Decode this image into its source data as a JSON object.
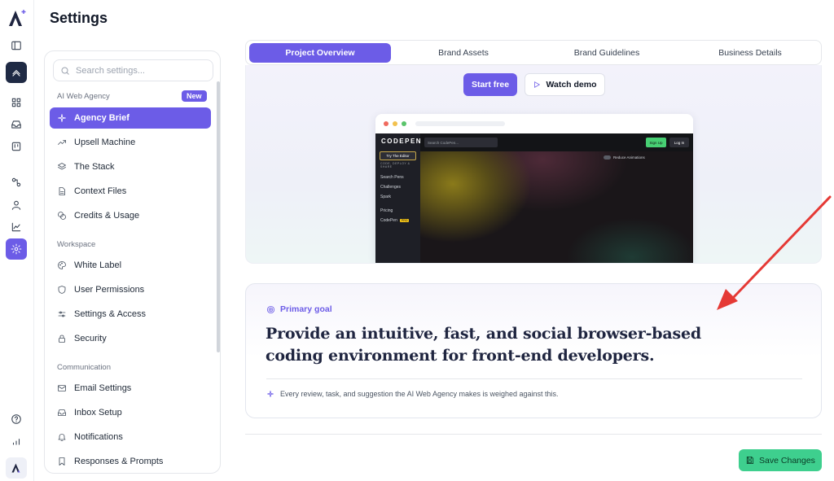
{
  "header": {
    "title": "Settings"
  },
  "sidebar": {
    "search_placeholder": "Search settings...",
    "sections": [
      {
        "heading": "AI Web Agency",
        "badge": "New"
      },
      {
        "heading": "Workspace"
      },
      {
        "heading": "Communication"
      }
    ],
    "items": [
      {
        "label": "Agency Brief",
        "icon": "sparkle-icon"
      },
      {
        "label": "Upsell Machine",
        "icon": "trend-up-icon"
      },
      {
        "label": "The Stack",
        "icon": "layers-icon"
      },
      {
        "label": "Context Files",
        "icon": "file-icon"
      },
      {
        "label": "Credits & Usage",
        "icon": "coins-icon"
      },
      {
        "label": "White Label",
        "icon": "palette-icon"
      },
      {
        "label": "User Permissions",
        "icon": "shield-icon"
      },
      {
        "label": "Settings & Access",
        "icon": "sliders-icon"
      },
      {
        "label": "Security",
        "icon": "lock-icon"
      },
      {
        "label": "Email Settings",
        "icon": "mail-icon"
      },
      {
        "label": "Inbox Setup",
        "icon": "inbox-icon"
      },
      {
        "label": "Notifications",
        "icon": "bell-icon"
      },
      {
        "label": "Responses & Prompts",
        "icon": "bookmark-icon"
      }
    ]
  },
  "tabs": [
    "Project Overview",
    "Brand Assets",
    "Brand Guidelines",
    "Business Details"
  ],
  "hero": {
    "start_label": "Start free",
    "watch_label": "Watch demo",
    "preview": {
      "logo": "CODEPEN",
      "try_editor": "Try The Editor",
      "tagline": "CODE, DEPLOY & SHARE",
      "search": "Search CodePen...",
      "signup": "Sign Up",
      "login": "Log In",
      "reduce": "Reduce Animations",
      "nav": [
        "Search Pens",
        "Challenges",
        "Spark",
        "Pricing",
        "CodePen"
      ],
      "pro": "PRO"
    }
  },
  "goal": {
    "label": "Primary goal",
    "text": "Provide an intuitive, fast, and social browser-based coding environment for front-end developers.",
    "note": "Every review, task, and suggestion the AI Web Agency makes is weighed against this."
  },
  "footer": {
    "save_label": "Save Changes"
  },
  "colors": {
    "accent": "#6c5ce7",
    "save": "#3ecf8e",
    "rail_dark": "#1f2a44",
    "arrow": "#e53935"
  }
}
